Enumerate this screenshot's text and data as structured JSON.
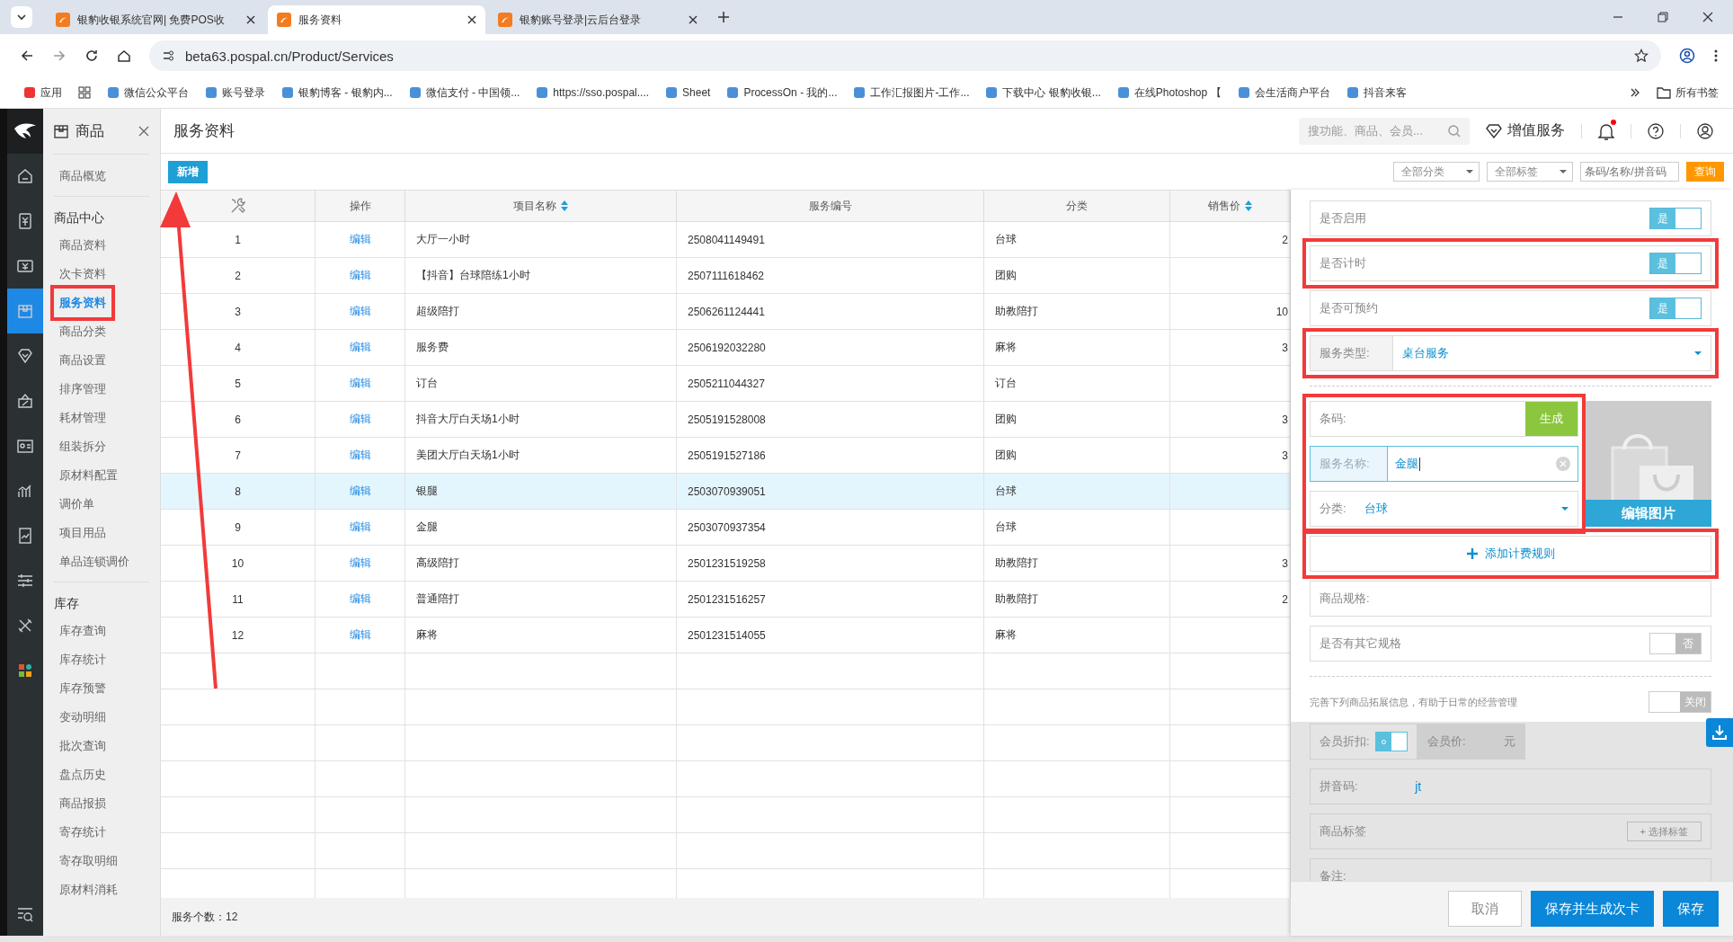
{
  "browser": {
    "tabs": [
      {
        "title": "银豹收银系统官网| 免费POS收",
        "selected": false
      },
      {
        "title": "服务资料",
        "selected": true
      },
      {
        "title": "银豹账号登录|云后台登录",
        "selected": false
      }
    ],
    "url": "beta63.pospal.cn/Product/Services",
    "bookmarks": [
      "应用",
      "微信公众平台",
      "账号登录",
      "银豹博客 - 银豹内...",
      "微信支付 - 中国领...",
      "https://sso.pospal....",
      "Sheet",
      "ProcessOn - 我的...",
      "工作汇报图片-工作...",
      "下载中心 银豹收银...",
      "在线Photoshop 【",
      "会生活商户平台",
      "抖音来客"
    ],
    "all_bookmarks": "所有书签"
  },
  "rail": [
    {
      "selected": false
    },
    {
      "selected": false
    },
    {
      "selected": false
    },
    {
      "selected": true
    },
    {
      "selected": false
    },
    {
      "selected": false
    },
    {
      "selected": false
    },
    {
      "selected": false
    },
    {
      "selected": false
    },
    {
      "selected": false
    },
    {
      "selected": false
    },
    {
      "selected": false
    }
  ],
  "sidebar": {
    "title": "商品",
    "groups": [
      {
        "items": [
          {
            "label": "商品概览",
            "selected": false,
            "highlighted": false
          }
        ]
      },
      {
        "heading": "商品中心",
        "items": [
          {
            "label": "商品资料",
            "selected": false,
            "highlighted": false
          },
          {
            "label": "次卡资料",
            "selected": false,
            "highlighted": false
          },
          {
            "label": "服务资料",
            "selected": true,
            "highlighted": true
          },
          {
            "label": "商品分类",
            "selected": false,
            "highlighted": false
          },
          {
            "label": "商品设置",
            "selected": false,
            "highlighted": false
          },
          {
            "label": "排序管理",
            "selected": false,
            "highlighted": false
          },
          {
            "label": "耗材管理",
            "selected": false,
            "highlighted": false
          },
          {
            "label": "组装拆分",
            "selected": false,
            "highlighted": false
          },
          {
            "label": "原材料配置",
            "selected": false,
            "highlighted": false
          },
          {
            "label": "调价单",
            "selected": false,
            "highlighted": false
          },
          {
            "label": "项目用品",
            "selected": false,
            "highlighted": false
          },
          {
            "label": "单品连锁调价",
            "selected": false,
            "highlighted": false
          }
        ]
      },
      {
        "heading": "库存",
        "items": [
          {
            "label": "库存查询",
            "selected": false,
            "highlighted": false
          },
          {
            "label": "库存统计",
            "selected": false,
            "highlighted": false
          },
          {
            "label": "库存预警",
            "selected": false,
            "highlighted": false
          },
          {
            "label": "变动明细",
            "selected": false,
            "highlighted": false
          },
          {
            "label": "批次查询",
            "selected": false,
            "highlighted": false
          },
          {
            "label": "盘点历史",
            "selected": false,
            "highlighted": false
          },
          {
            "label": "商品报损",
            "selected": false,
            "highlighted": false
          },
          {
            "label": "寄存统计",
            "selected": false,
            "highlighted": false
          },
          {
            "label": "寄存取明细",
            "selected": false,
            "highlighted": false
          },
          {
            "label": "原材料消耗",
            "selected": false,
            "highlighted": false
          }
        ]
      }
    ]
  },
  "header": {
    "title": "服务资料",
    "search_placeholder": "搜功能、商品、会员...",
    "value_service": "增值服务",
    "notification_dot": true
  },
  "toolbar": {
    "add_button": "新增",
    "category_filter": "全部分类",
    "tag_filter": "全部标签",
    "search_placeholder": "条码/名称/拼音码",
    "query_button": "查询"
  },
  "table": {
    "columns": [
      {
        "label": "操作",
        "sortable": false
      },
      {
        "label": "项目名称",
        "sortable": true
      },
      {
        "label": "服务编号",
        "sortable": false
      },
      {
        "label": "分类",
        "sortable": false
      },
      {
        "label": "销售价",
        "sortable": true
      }
    ],
    "rows": [
      {
        "index": "1",
        "action": "编辑",
        "name": "大厅一小时",
        "code": "2508041149491",
        "category": "台球",
        "price": "2",
        "selected": false
      },
      {
        "index": "2",
        "action": "编辑",
        "name": "【抖音】台球陪练1小时",
        "code": "2507111618462",
        "category": "团购",
        "price": null,
        "selected": false
      },
      {
        "index": "3",
        "action": "编辑",
        "name": "超级陪打",
        "code": "2506261124441",
        "category": "助教陪打",
        "price": "10",
        "selected": false
      },
      {
        "index": "4",
        "action": "编辑",
        "name": "服务费",
        "code": "2506192032280",
        "category": "麻将",
        "price": "3",
        "selected": false
      },
      {
        "index": "5",
        "action": "编辑",
        "name": "订台",
        "code": "2505211044327",
        "category": "订台",
        "price": null,
        "selected": false
      },
      {
        "index": "6",
        "action": "编辑",
        "name": "抖音大厅白天场1小时",
        "code": "2505191528008",
        "category": "团购",
        "price": "3",
        "selected": false
      },
      {
        "index": "7",
        "action": "编辑",
        "name": "美团大厅白天场1小时",
        "code": "2505191527186",
        "category": "团购",
        "price": "3",
        "selected": false
      },
      {
        "index": "8",
        "action": "编辑",
        "name": "银腿",
        "code": "2503070939051",
        "category": "台球",
        "price": null,
        "selected": true
      },
      {
        "index": "9",
        "action": "编辑",
        "name": "金腿",
        "code": "2503070937354",
        "category": "台球",
        "price": null,
        "selected": false
      },
      {
        "index": "10",
        "action": "编辑",
        "name": "高级陪打",
        "code": "2501231519258",
        "category": "助教陪打",
        "price": "3",
        "selected": false
      },
      {
        "index": "11",
        "action": "编辑",
        "name": "普通陪打",
        "code": "2501231516257",
        "category": "助教陪打",
        "price": "2",
        "selected": false
      },
      {
        "index": "12",
        "action": "编辑",
        "name": "麻将",
        "code": "2501231514055",
        "category": "麻将",
        "price": null,
        "selected": false
      }
    ],
    "footer": "服务个数：12"
  },
  "form": {
    "sections": [
      {
        "kind": "toggle",
        "label": "是否启用",
        "on": true,
        "text": "是",
        "highlighted": false
      },
      {
        "kind": "toggle",
        "label": "是否计时",
        "on": true,
        "text": "是",
        "highlighted": true
      },
      {
        "kind": "toggle",
        "label": "是否可预约",
        "on": true,
        "text": "是",
        "highlighted": false
      },
      {
        "kind": "select",
        "label": "服务类型:",
        "value": "桌台服务",
        "highlighted": true
      },
      {
        "kind": "divider"
      },
      {
        "kind": "basic",
        "highlighted": true,
        "barcode_label": "条码:",
        "generate_button": "生成",
        "name_label": "服务名称:",
        "name_value": "金腿",
        "category_label": "分类:",
        "category_value": "台球",
        "image_button": "编辑图片"
      },
      {
        "kind": "button",
        "text": "添加计费规则",
        "highlighted": true
      },
      {
        "kind": "field",
        "label": "商品规格:",
        "highlighted": false
      },
      {
        "kind": "toggle",
        "label": "是否有其它规格",
        "on": false,
        "text": "否",
        "highlighted": false
      },
      {
        "kind": "divider"
      },
      {
        "kind": "hint",
        "text": "完善下列商品拓展信息，有助于日常的经营管理",
        "on": false,
        "toggle_text": "关闭"
      }
    ],
    "extended": {
      "disabled": true,
      "member_discount_label": "会员折扣:",
      "member_discount_on": true,
      "member_price_label": "会员价:",
      "member_price_unit": "元",
      "pinyin_label": "拼音码:",
      "pinyin_value": "jt",
      "tags_label": "商品标签",
      "tags_button": "+ 选择标签",
      "note_label": "备注:"
    },
    "buttons": [
      {
        "text": "取消",
        "kind": "secondary"
      },
      {
        "text": "保存并生成次卡",
        "kind": "primary"
      },
      {
        "text": "保存",
        "kind": "primary"
      }
    ]
  }
}
